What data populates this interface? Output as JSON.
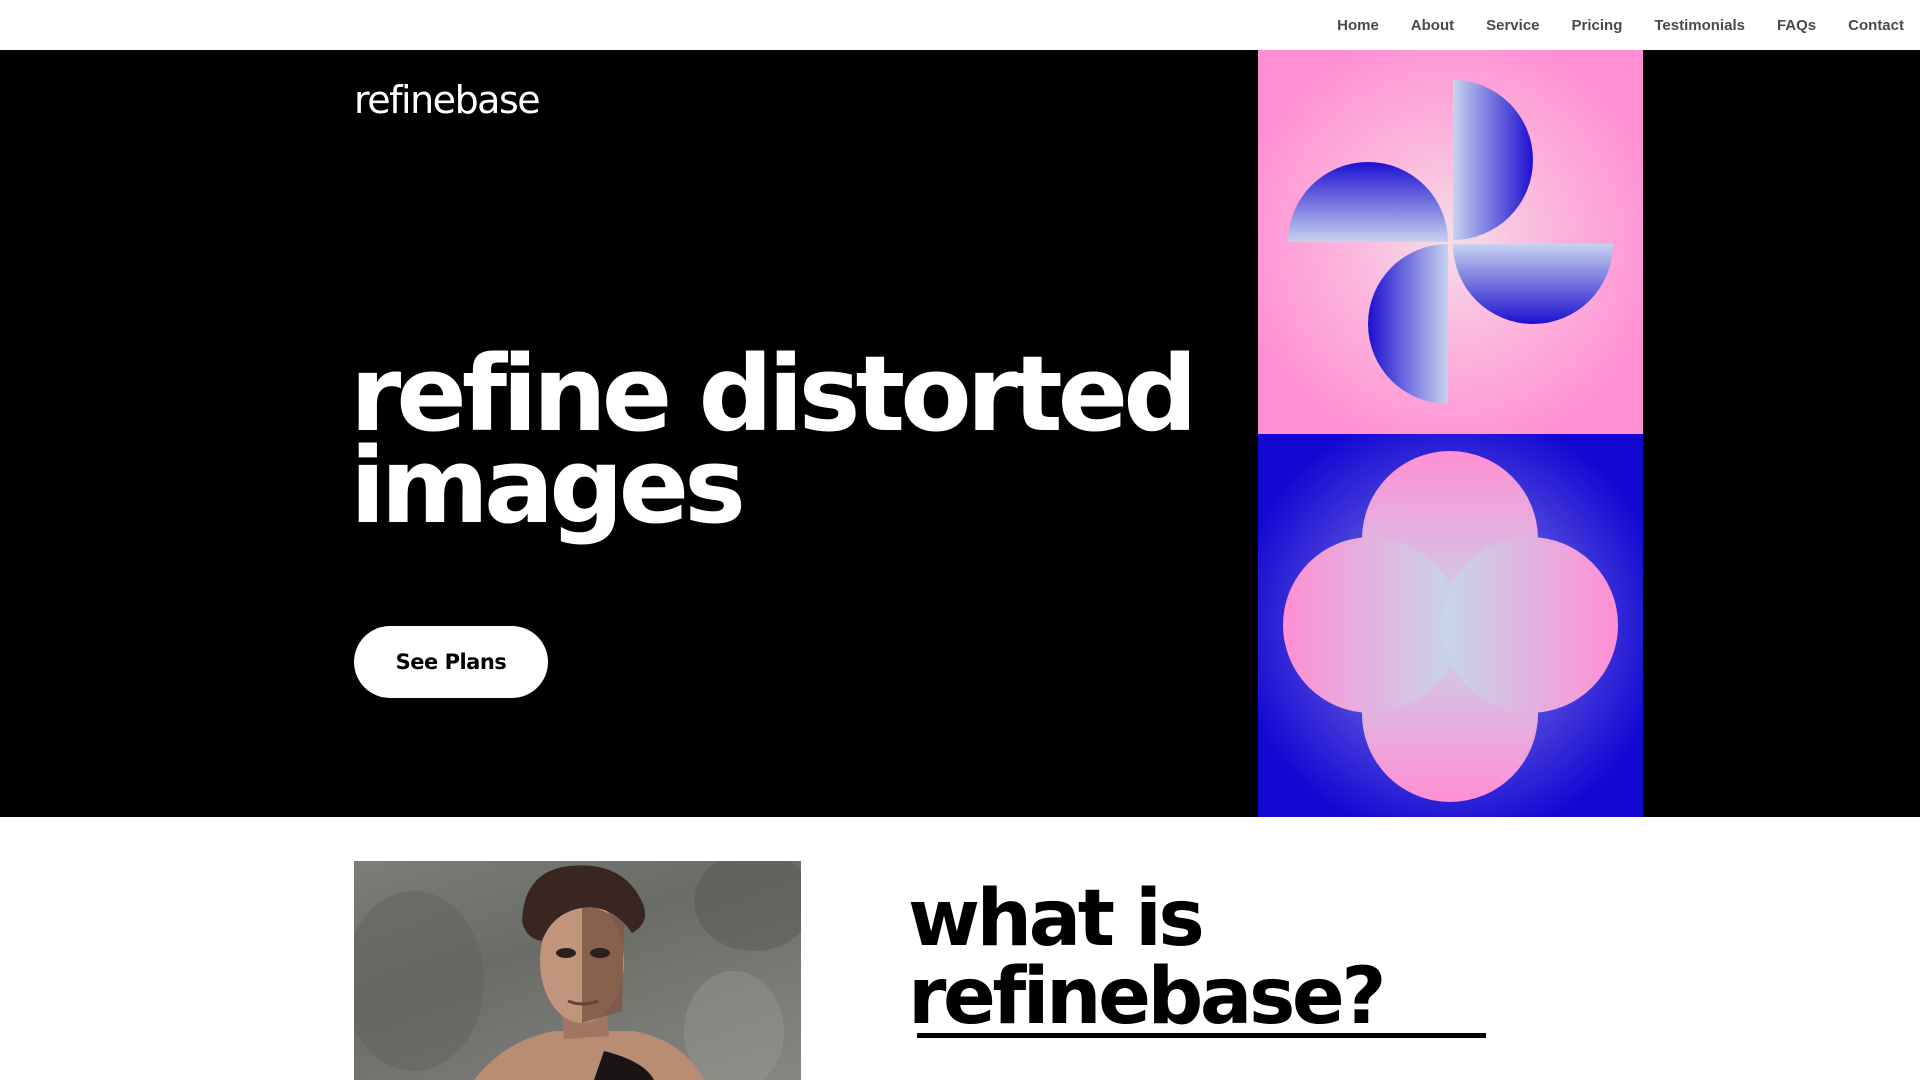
{
  "nav": {
    "items": [
      "Home",
      "About",
      "Service",
      "Pricing",
      "Testimonials",
      "FAQs",
      "Contact"
    ]
  },
  "hero": {
    "logo": "refinebase",
    "headline_line1": "refine distorted",
    "headline_line2": "images",
    "cta_label": "See Plans",
    "art": {
      "top_panel_bg": "#ff8fd3",
      "bottom_panel_bg": "#1308d2",
      "top_icon": "pinwheel-graphic",
      "bottom_icon": "four-circle-flower-graphic"
    }
  },
  "about": {
    "title_line1": "what is",
    "title_line2": "refinebase?",
    "image_icon": "distorted-portrait-photo"
  },
  "colors": {
    "hero_bg": "#000000",
    "nav_text": "#4a4a4a",
    "pink": "#ff8fd3",
    "blue": "#1308d2"
  }
}
